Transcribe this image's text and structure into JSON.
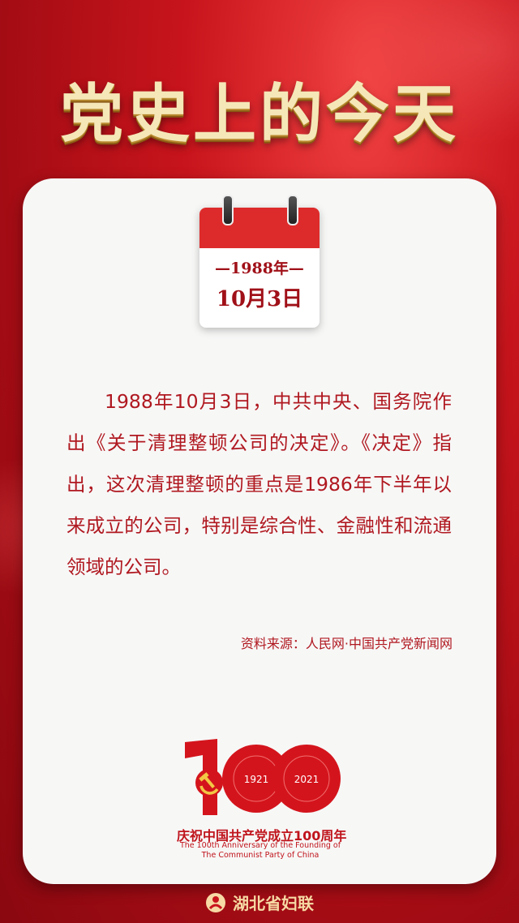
{
  "header": {
    "title": "党史上的今天"
  },
  "calendar": {
    "year": "—1988年—",
    "date": "10月3日"
  },
  "article": {
    "body": "1988年10月3日，中共中央、国务院作出《关于清理整顿公司的决定》。《决定》指出，这次清理整顿的重点是1986年下半年以来成立的公司，特别是综合性、金融性和流通领域的公司。",
    "source": "资料来源：人民网·中国共产党新闻网"
  },
  "emblem": {
    "year_start": "1921",
    "year_end": "2021",
    "slogan": "庆祝中国共产党成立100周年",
    "english_line1": "The 100th Anniversary of the Founding of",
    "english_line2": "The Communist Party of China"
  },
  "footer": {
    "org_name": "湖北省妇联"
  },
  "colors": {
    "brand_red": "#c8141c",
    "text_red": "#b01820",
    "gold": "#f5e7b8"
  }
}
